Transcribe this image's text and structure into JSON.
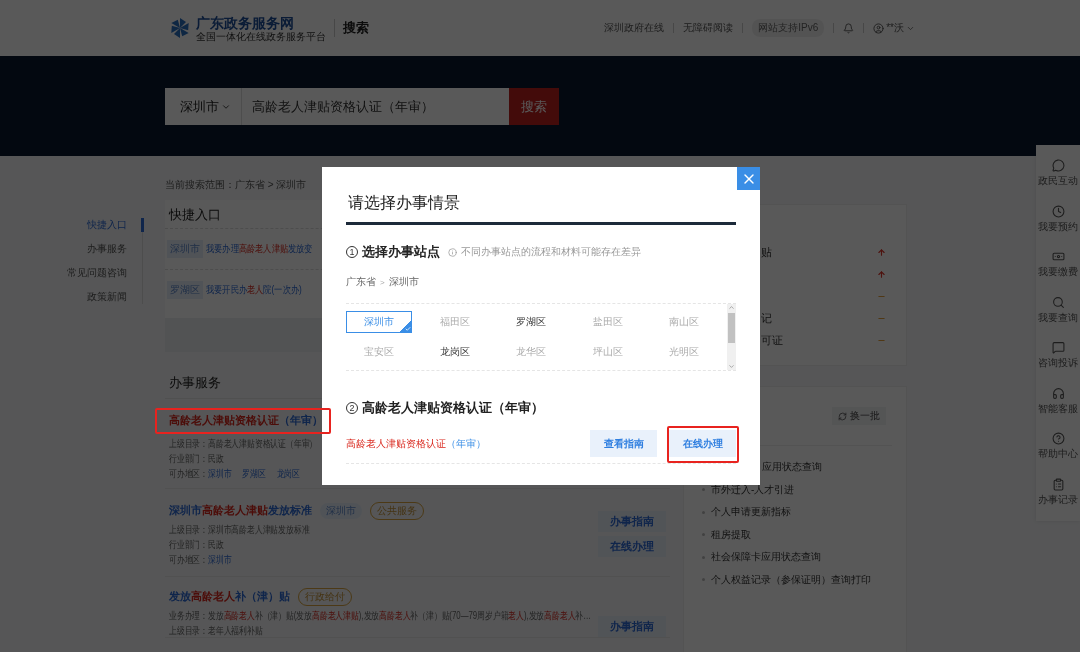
{
  "header": {
    "logo_title": "广东政务服务网",
    "logo_subtitle": "全国一体化在线政务服务平台",
    "section": "搜索",
    "links": [
      "深圳政府在线",
      "无障碍阅读"
    ],
    "badge": "网站支持IPv6",
    "user": "**沃"
  },
  "search": {
    "region": "深圳市",
    "value": "高龄老人津贴资格认证（年审）",
    "button": "搜索"
  },
  "scope": "当前搜索范围：广东省 > 深圳市",
  "side_nav": [
    {
      "label": "快捷入口",
      "selected": true
    },
    {
      "label": "办事服务",
      "selected": false
    },
    {
      "label": "常见问题咨询",
      "selected": false
    },
    {
      "label": "政策新闻",
      "selected": false
    }
  ],
  "quick_entry": {
    "title": "快捷入口",
    "items": [
      {
        "tag": "深圳市",
        "parts": [
          {
            "text": "我要办理",
            "hl": false
          },
          {
            "text": "高龄老人津贴",
            "hl": true
          },
          {
            "text": "发放变",
            "hl": false
          }
        ]
      },
      {
        "tag": "罗湖区",
        "parts": [
          {
            "text": "我要开民办",
            "hl": false
          },
          {
            "text": "老人",
            "hl": true
          },
          {
            "text": "院(一次办)",
            "hl": false
          }
        ]
      }
    ]
  },
  "services": {
    "title": "办事服务",
    "items": [
      {
        "annotated": true,
        "title_parts": [
          {
            "text": "高龄老人津贴资格认证",
            "hl": true
          },
          {
            "text": "（年审）",
            "hl": false
          }
        ],
        "lines": [
          {
            "label": "上级目录：",
            "value": "高龄老人津贴资格认证（年审）"
          },
          {
            "label": "行业部门：",
            "value": "民政"
          }
        ],
        "regions_label": "可办地区：",
        "regions": [
          "深圳市",
          "罗湖区",
          "龙岗区"
        ]
      },
      {
        "annotated": false,
        "title_parts": [
          {
            "text": "深圳市",
            "hl": false
          },
          {
            "text": "高龄老人津贴",
            "hl": true
          },
          {
            "text": "发放标准",
            "hl": false
          }
        ],
        "tags": [
          {
            "text": "深圳市",
            "kind": "region"
          },
          {
            "text": "公共服务",
            "kind": "type"
          }
        ],
        "lines": [
          {
            "label": "上级目录：",
            "value": "深圳市高龄老人津贴发放标准"
          },
          {
            "label": "行业部门：",
            "value": "民政"
          }
        ],
        "regions_label": "可办地区：",
        "regions": [
          "深圳市"
        ],
        "buttons": [
          "办事指南",
          "在线办理"
        ]
      },
      {
        "annotated": false,
        "title_parts": [
          {
            "text": "发放",
            "hl": false
          },
          {
            "text": "高龄老人",
            "hl": true
          },
          {
            "text": "补（津）贴",
            "hl": false
          }
        ],
        "tags": [
          {
            "text": "行政给付",
            "kind": "type"
          }
        ],
        "business": {
          "label": "业务办理：",
          "parts": [
            {
              "text": "发放",
              "hl": false
            },
            {
              "text": "高龄老人",
              "hl": true
            },
            {
              "text": "补（津）贴(发放",
              "hl": false
            },
            {
              "text": "高龄老人津贴",
              "hl": true
            },
            {
              "text": "),发放",
              "hl": false
            },
            {
              "text": "高龄老人",
              "hl": true
            },
            {
              "text": "补（津）贴(70—79周岁户籍",
              "hl": false
            },
            {
              "text": "老人",
              "hl": true
            },
            {
              "text": "),发放",
              "hl": false
            },
            {
              "text": "高龄老人",
              "hl": true
            },
            {
              "text": "补…",
              "hl": false
            }
          ]
        },
        "lines": [
          {
            "label": "上级目录：",
            "value": "老年人福利补贴"
          }
        ],
        "buttons": [
          "办事指南"
        ]
      }
    ]
  },
  "hot_list": [
    {
      "text": "贴",
      "rising": true
    },
    {
      "rising": true
    },
    {
      "rising": false
    },
    {
      "text": "记",
      "rising": false
    },
    {
      "text": "可证",
      "rising": false
    }
  ],
  "recommend": {
    "button": "换一批",
    "items": [
      {
        "text": "应用状态查询",
        "bullet": false
      },
      {
        "text": "市外迁入-人才引进",
        "bullet": true
      },
      {
        "text": "个人申请更新指标",
        "bullet": true
      },
      {
        "text": "租房提取",
        "bullet": true
      },
      {
        "text": "社会保障卡应用状态查询",
        "bullet": true
      },
      {
        "text": "个人权益记录（参保证明）查询打印",
        "bullet": true
      }
    ]
  },
  "float_bar": [
    {
      "label": "政民互动"
    },
    {
      "label": "我要预约"
    },
    {
      "label": "我要缴费"
    },
    {
      "label": "我要查询"
    },
    {
      "label": "咨询投诉"
    },
    {
      "label": "智能客服"
    },
    {
      "label": "帮助中心"
    },
    {
      "label": "办事记录"
    }
  ],
  "modal": {
    "title": "请选择办事情景",
    "step1": {
      "number": "1",
      "title": "选择办事站点",
      "hint": "不同办事站点的流程和材料可能存在差异",
      "path": [
        "广东省",
        "深圳市"
      ],
      "sep": ">"
    },
    "districts": [
      {
        "name": "深圳市",
        "selected": true,
        "disabled": false
      },
      {
        "name": "福田区",
        "selected": false,
        "disabled": true
      },
      {
        "name": "罗湖区",
        "selected": false,
        "disabled": false
      },
      {
        "name": "盐田区",
        "selected": false,
        "disabled": true
      },
      {
        "name": "南山区",
        "selected": false,
        "disabled": true
      },
      {
        "name": "宝安区",
        "selected": false,
        "disabled": true
      },
      {
        "name": "龙岗区",
        "selected": false,
        "disabled": false
      },
      {
        "name": "龙华区",
        "selected": false,
        "disabled": true
      },
      {
        "name": "坪山区",
        "selected": false,
        "disabled": true
      },
      {
        "name": "光明区",
        "selected": false,
        "disabled": true
      }
    ],
    "step2": {
      "number": "2",
      "title": "高龄老人津贴资格认证（年审）"
    },
    "item": {
      "parts": [
        {
          "text": "高龄老人津贴资格认证",
          "hl": true
        },
        {
          "text": "（年审）",
          "hl": false
        }
      ],
      "buttons": [
        {
          "label": "查看指南",
          "annotated": false
        },
        {
          "label": "在线办理",
          "annotated": true
        }
      ]
    }
  }
}
